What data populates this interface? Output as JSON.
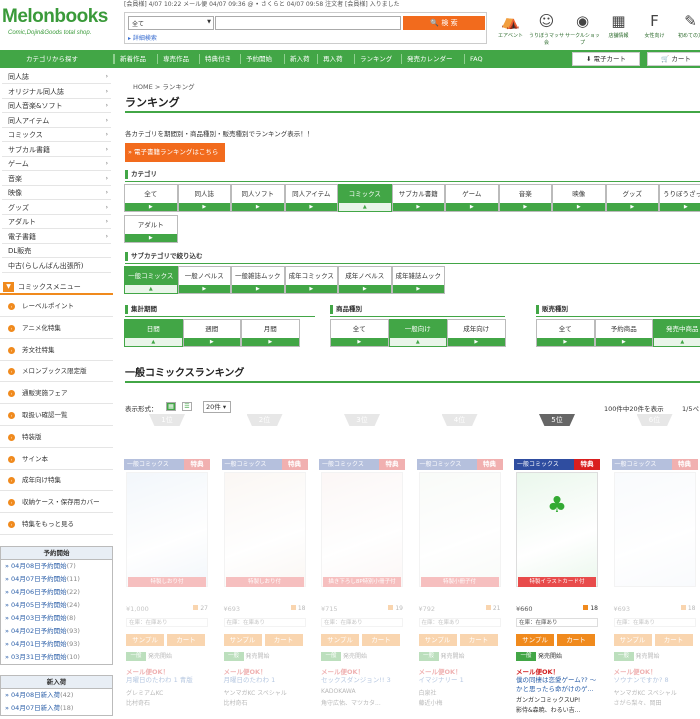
{
  "header": {
    "logo_name": "Melonbooks",
    "logo_tagline": "Comic,Dojin&Goods total shop.",
    "ticker": "[会員様] 4/07 10:22 メール便 04/07 09:36 @ • さくらと 04/07 09:58 注文者 [会員様] 入りました",
    "search_select": "全て",
    "search_placeholder": "",
    "search_button": "検 索",
    "advanced_search": "詳細検索",
    "icons": [
      {
        "label": "エアベント",
        "icon": "tent-icon",
        "glyph": "⛺"
      },
      {
        "label": "うりぼうマッサ会",
        "icon": "mascot-icon",
        "glyph": "☺"
      },
      {
        "label": "サークルショップ",
        "icon": "circle-shop-icon",
        "glyph": "◉"
      },
      {
        "label": "店舗情報",
        "icon": "store-icon",
        "glyph": "▦"
      },
      {
        "label": "女性向け",
        "icon": "female-icon",
        "glyph": "F"
      },
      {
        "label": "初めての方",
        "icon": "beginner-icon",
        "glyph": "✎"
      }
    ]
  },
  "nav": {
    "category_button": "カテゴリから探す",
    "items": [
      "新着作品",
      "専売作品",
      "特典付き",
      "予約開始",
      "新入荷",
      "再入荷",
      "ランキング",
      "発売カレンダー",
      "FAQ"
    ],
    "ebook_cart": "電子カート",
    "cart": "カート"
  },
  "sidebar": {
    "categories": [
      "同人誌",
      "オリジナル同人誌",
      "同人音楽&ソフト",
      "同人アイテム",
      "コミックス",
      "サブカル書籍",
      "ゲーム",
      "音楽",
      "映像",
      "グッズ",
      "アダルト",
      "電子書籍",
      "DL販売",
      "中古(らしんばん出張所)"
    ],
    "menu_title": "コミックスメニュー",
    "menu_items": [
      "レーベルポイント",
      "アニメ化特集",
      "芳文社特集",
      "メロンブックス限定版",
      "通販実施フェア",
      "取扱い確認一覧",
      "特装版",
      "サイン本",
      "成年向け特集",
      "収納ケース・保存用カバー",
      "特集をもっと見る"
    ],
    "preorder": {
      "title": "予約開始",
      "items": [
        [
          "04月08日予約開始",
          "(7)"
        ],
        [
          "04月07日予約開始",
          "(11)"
        ],
        [
          "04月06日予約開始",
          "(22)"
        ],
        [
          "04月05日予約開始",
          "(24)"
        ],
        [
          "04月03日予約開始",
          "(8)"
        ],
        [
          "04月02日予約開始",
          "(93)"
        ],
        [
          "04月01日予約開始",
          "(93)"
        ],
        [
          "03月31日予約開始",
          "(10)"
        ]
      ]
    },
    "arrival": {
      "title": "新入荷",
      "items": [
        [
          "04月08日新入荷",
          "(42)"
        ],
        [
          "04月07日新入荷",
          "(18)"
        ]
      ]
    }
  },
  "main": {
    "breadcrumb": [
      "HOME",
      "ランキング"
    ],
    "title": "ランキング",
    "description": "各カテゴリを期間別・商品種別・販売種別でランキング表示！！",
    "ebook_button": "電子書籍ランキングはこちら",
    "category": {
      "label": "カテゴリ",
      "tabs": [
        "全て",
        "同人誌",
        "同人ソフト",
        "同人アイテム",
        "コミックス",
        "サブカル書籍",
        "ゲーム",
        "音楽",
        "映像",
        "グッズ",
        "うりぼうざっか",
        "アダルト"
      ]
    },
    "sub": {
      "label": "サブカテゴリで絞り込む",
      "tabs": [
        "一般コミックス",
        "一般ノベルス",
        "一般雑誌ムック",
        "成年コミックス",
        "成年ノベルス",
        "成年雑誌ムック"
      ]
    },
    "period": {
      "label": "集計期間",
      "tabs": [
        "日間",
        "週間",
        "月間"
      ]
    },
    "product": {
      "label": "商品種別",
      "tabs": [
        "全て",
        "一般向け",
        "成年向け"
      ]
    },
    "sales": {
      "label": "販売種別",
      "tabs": [
        "全て",
        "予約商品",
        "発売中商品"
      ]
    },
    "heading": "一般コミックスランキング",
    "display_mode": "表示形式：",
    "per_page": "20件",
    "total": "100件中20件を表示",
    "page": "1/5ペ"
  },
  "products": [
    {
      "rank": "1位",
      "cat": "一般コミックス",
      "tok": "特典",
      "note": "特製しおり付",
      "price": "¥1,000",
      "pts": "27",
      "stock": "在庫：在庫あり",
      "b1": "サンプル",
      "b2": "カート",
      "tg1": "一般",
      "tg2": "発売開始",
      "mail": "メール便OK！",
      "title": "月曜日のたわわ 1 青版",
      "pub": "グレミアムKC",
      "author": "比村奇石"
    },
    {
      "rank": "2位",
      "cat": "一般コミックス",
      "tok": "特典",
      "note": "特製しおり付",
      "price": "¥693",
      "pts": "18",
      "stock": "在庫：在庫あり",
      "b1": "サンプル",
      "b2": "カート",
      "tg1": "一般",
      "tg2": "発売開始",
      "mail": "メール便OK！",
      "title": "月曜日のたわわ 1",
      "pub": "ヤンマガKC スペシャル",
      "author": "比村奇石"
    },
    {
      "rank": "3位",
      "cat": "一般コミックス",
      "tok": "特典",
      "note": "描き下ろし8P特別小冊子付",
      "price": "¥715",
      "pts": "19",
      "stock": "在庫：在庫あり",
      "b1": "サンプル",
      "b2": "カート",
      "tg1": "一般",
      "tg2": "発売開始",
      "mail": "メール便OK！",
      "title": "セックスダンジョン!! 3",
      "pub": "KADOKAWA",
      "author": "角守広佑、マツカタ..."
    },
    {
      "rank": "4位",
      "cat": "一般コミックス",
      "tok": "特典",
      "note": "特製小冊子付",
      "price": "¥792",
      "pts": "21",
      "stock": "在庫：在庫あり",
      "b1": "サンプル",
      "b2": "カート",
      "tg1": "一般",
      "tg2": "発売開始",
      "mail": "メール便OK！",
      "title": "イマジナリー 1",
      "pub": "白泉社",
      "author": "藤近小梅"
    },
    {
      "rank": "5位",
      "cat": "一般コミックス",
      "tok": "特典",
      "note": "特製イラストカード付",
      "price": "¥660",
      "pts": "18",
      "stock": "在庫：在庫あり",
      "b1": "サンプル",
      "b2": "カート",
      "tg1": "一般",
      "tg2": "発売開始",
      "mail": "メール便OK！",
      "title": "僕の同棲は恋愛ゲーム?? ～かと思ったら命がけのゲ...",
      "pub": "ガンガンコミックスUP!",
      "author": "影侍&森暁、わるい吉..."
    },
    {
      "rank": "6位",
      "cat": "一般コミックス",
      "tok": "特典",
      "note": "",
      "price": "¥693",
      "pts": "18",
      "stock": "在庫：在庫あり",
      "b1": "サンプル",
      "b2": "カート",
      "tg1": "一般",
      "tg2": "発売開始",
      "mail": "メール便OK！",
      "title": "ソウナンですか? 8",
      "pub": "ヤンマガKC スペシャル",
      "author": "さがら梨々、岡田"
    }
  ],
  "colors": {
    "accent": "#42a646",
    "orange": "#f08a1d",
    "blue_badge": "#2f4da0",
    "red": "#d91f1f"
  }
}
